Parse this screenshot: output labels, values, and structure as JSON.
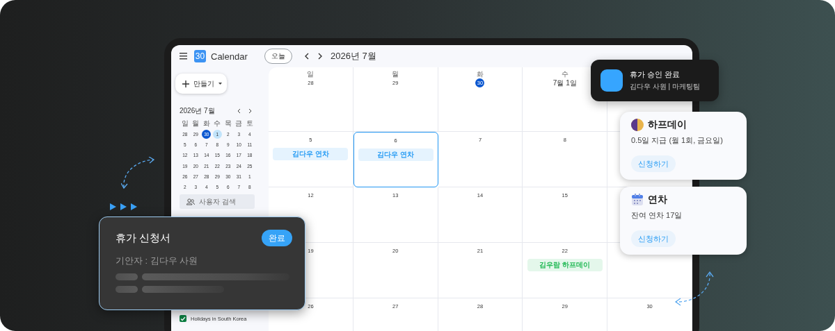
{
  "app": {
    "logo": "30",
    "title": "Calendar"
  },
  "toolbar": {
    "today_button": "오늘",
    "month_title": "2026년 7월"
  },
  "sidebar": {
    "create_button": "만들기",
    "mini_calendar": {
      "title": "2026년 7월",
      "weekdays": [
        "일",
        "월",
        "화",
        "수",
        "목",
        "금",
        "토"
      ],
      "weeks": [
        [
          {
            "day": "28",
            "today": false,
            "selected": false
          },
          {
            "day": "29",
            "today": false,
            "selected": false
          },
          {
            "day": "30",
            "today": true,
            "selected": false
          },
          {
            "day": "1",
            "today": false,
            "selected": true
          },
          {
            "day": "2",
            "today": false,
            "selected": false
          },
          {
            "day": "3",
            "today": false,
            "selected": false
          },
          {
            "day": "4",
            "today": false,
            "selected": false
          }
        ],
        [
          {
            "day": "5",
            "today": false,
            "selected": false
          },
          {
            "day": "6",
            "today": false,
            "selected": false
          },
          {
            "day": "7",
            "today": false,
            "selected": false
          },
          {
            "day": "8",
            "today": false,
            "selected": false
          },
          {
            "day": "9",
            "today": false,
            "selected": false
          },
          {
            "day": "10",
            "today": false,
            "selected": false
          },
          {
            "day": "11",
            "today": false,
            "selected": false
          }
        ],
        [
          {
            "day": "12",
            "today": false,
            "selected": false
          },
          {
            "day": "13",
            "today": false,
            "selected": false
          },
          {
            "day": "14",
            "today": false,
            "selected": false
          },
          {
            "day": "15",
            "today": false,
            "selected": false
          },
          {
            "day": "16",
            "today": false,
            "selected": false
          },
          {
            "day": "17",
            "today": false,
            "selected": false
          },
          {
            "day": "18",
            "today": false,
            "selected": false
          }
        ],
        [
          {
            "day": "19",
            "today": false,
            "selected": false
          },
          {
            "day": "20",
            "today": false,
            "selected": false
          },
          {
            "day": "21",
            "today": false,
            "selected": false
          },
          {
            "day": "22",
            "today": false,
            "selected": false
          },
          {
            "day": "23",
            "today": false,
            "selected": false
          },
          {
            "day": "24",
            "today": false,
            "selected": false
          },
          {
            "day": "25",
            "today": false,
            "selected": false
          }
        ],
        [
          {
            "day": "26",
            "today": false,
            "selected": false
          },
          {
            "day": "27",
            "today": false,
            "selected": false
          },
          {
            "day": "28",
            "today": false,
            "selected": false
          },
          {
            "day": "29",
            "today": false,
            "selected": false
          },
          {
            "day": "30",
            "today": false,
            "selected": false
          },
          {
            "day": "31",
            "today": false,
            "selected": false
          },
          {
            "day": "1",
            "today": false,
            "selected": false
          }
        ],
        [
          {
            "day": "2",
            "today": false,
            "selected": false
          },
          {
            "day": "3",
            "today": false,
            "selected": false
          },
          {
            "day": "4",
            "today": false,
            "selected": false
          },
          {
            "day": "5",
            "today": false,
            "selected": false
          },
          {
            "day": "6",
            "today": false,
            "selected": false
          },
          {
            "day": "7",
            "today": false,
            "selected": false
          },
          {
            "day": "8",
            "today": false,
            "selected": false
          }
        ]
      ]
    },
    "people_search": {
      "placeholder": "사용자 검색"
    },
    "calendars": [
      {
        "label": "Holidays in South Korea",
        "checked": true,
        "color": "#0b8043"
      }
    ]
  },
  "month_grid": {
    "weekdays": [
      "일",
      "월",
      "화",
      "수"
    ],
    "weeks": [
      [
        {
          "date": "28",
          "today": false,
          "selected": false
        },
        {
          "date": "29",
          "today": false,
          "selected": false
        },
        {
          "date": "30",
          "today": true,
          "selected": false
        },
        {
          "date": "7월 1일",
          "today": false,
          "selected": false
        }
      ],
      [
        {
          "date": "5",
          "today": false,
          "selected": false,
          "events": [
            {
              "title": "김다우 연차",
              "color": "#2a9df4"
            }
          ]
        },
        {
          "date": "6",
          "today": false,
          "selected": true,
          "events": [
            {
              "title": "김다우 연차",
              "color": "#2a9df4"
            }
          ]
        },
        {
          "date": "7",
          "today": false,
          "selected": false
        },
        {
          "date": "8",
          "today": false,
          "selected": false
        }
      ],
      [
        {
          "date": "12",
          "today": false,
          "selected": false
        },
        {
          "date": "13",
          "today": false,
          "selected": false
        },
        {
          "date": "14",
          "today": false,
          "selected": false
        },
        {
          "date": "15",
          "today": false,
          "selected": false
        }
      ],
      [
        {
          "date": "19",
          "today": false,
          "selected": false
        },
        {
          "date": "20",
          "today": false,
          "selected": false
        },
        {
          "date": "21",
          "today": false,
          "selected": false
        },
        {
          "date": "22",
          "today": false,
          "selected": false,
          "events": [
            {
              "title": "김우람 하프데이",
              "color": "#22b955"
            }
          ]
        }
      ],
      [
        {
          "date": "26",
          "today": false,
          "selected": false
        },
        {
          "date": "27",
          "today": false,
          "selected": false
        },
        {
          "date": "28",
          "today": false,
          "selected": false
        },
        {
          "date": "29",
          "today": false,
          "selected": false
        },
        {
          "date": "30",
          "today": false,
          "selected": false
        }
      ]
    ]
  },
  "request_card": {
    "title": "휴가 신청서",
    "status": "완료",
    "drafter": "기안자 : 김다우 사원"
  },
  "notification": {
    "title": "휴가 승인 완료",
    "subtitle": "김다우 사원 | 마케팅팀"
  },
  "leave_cards": [
    {
      "kind": "halfday",
      "title": "하프데이",
      "description": "0.5일 지급 (월 1회, 금요일)",
      "button": "신청하기"
    },
    {
      "kind": "annual",
      "title": "연차",
      "description": "잔여 연차 17일",
      "button": "신청하기"
    }
  ]
}
